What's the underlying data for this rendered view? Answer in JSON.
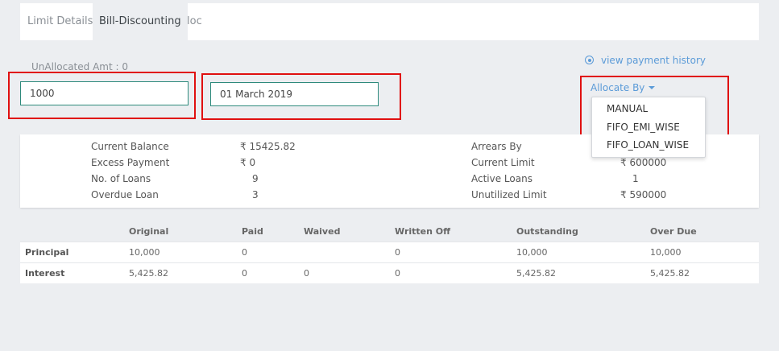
{
  "tabs": [
    {
      "label": "Limit Details",
      "active": false
    },
    {
      "label": "Bill-Discounting",
      "active": true
    },
    {
      "label": "loc",
      "active": false
    }
  ],
  "unallocated_label": "UnAllocated Amt : 0",
  "amount_value": "1000",
  "date_value": "01 March 2019",
  "view_history_link": "view payment history",
  "allocate_by": {
    "label": "Allocate By",
    "options": [
      "MANUAL",
      "FIFO_EMI_WISE",
      "FIFO_LOAN_WISE"
    ]
  },
  "summary": {
    "current_balance": {
      "label": "Current Balance",
      "value": "₹ 15425.82"
    },
    "excess_payment": {
      "label": "Excess Payment",
      "value": "₹ 0"
    },
    "no_of_loans": {
      "label": "No. of Loans",
      "value": "9"
    },
    "overdue_loan": {
      "label": "Overdue Loan",
      "value": "3"
    },
    "arrears_by": {
      "label": "Arrears By",
      "value": ""
    },
    "current_limit": {
      "label": "Current Limit",
      "value": "₹ 600000"
    },
    "active_loans": {
      "label": "Active Loans",
      "value": "1"
    },
    "unutilized_limit": {
      "label": "Unutilized Limit",
      "value": "₹ 590000"
    }
  },
  "table": {
    "headers": [
      "",
      "Original",
      "Paid",
      "Waived",
      "Written Off",
      "Outstanding",
      "Over Due"
    ],
    "rows": [
      {
        "label": "Principal",
        "original": "10,000",
        "paid": "0",
        "waived": "",
        "written_off": "0",
        "outstanding": "10,000",
        "over_due": "10,000"
      },
      {
        "label": "Interest",
        "original": "5,425.82",
        "paid": "0",
        "waived": "0",
        "written_off": "0",
        "outstanding": "5,425.82",
        "over_due": "5,425.82"
      }
    ]
  },
  "colors": {
    "accent_link": "#5b9bd8",
    "highlight_box": "#e01010",
    "input_border": "#2e8a7c"
  }
}
